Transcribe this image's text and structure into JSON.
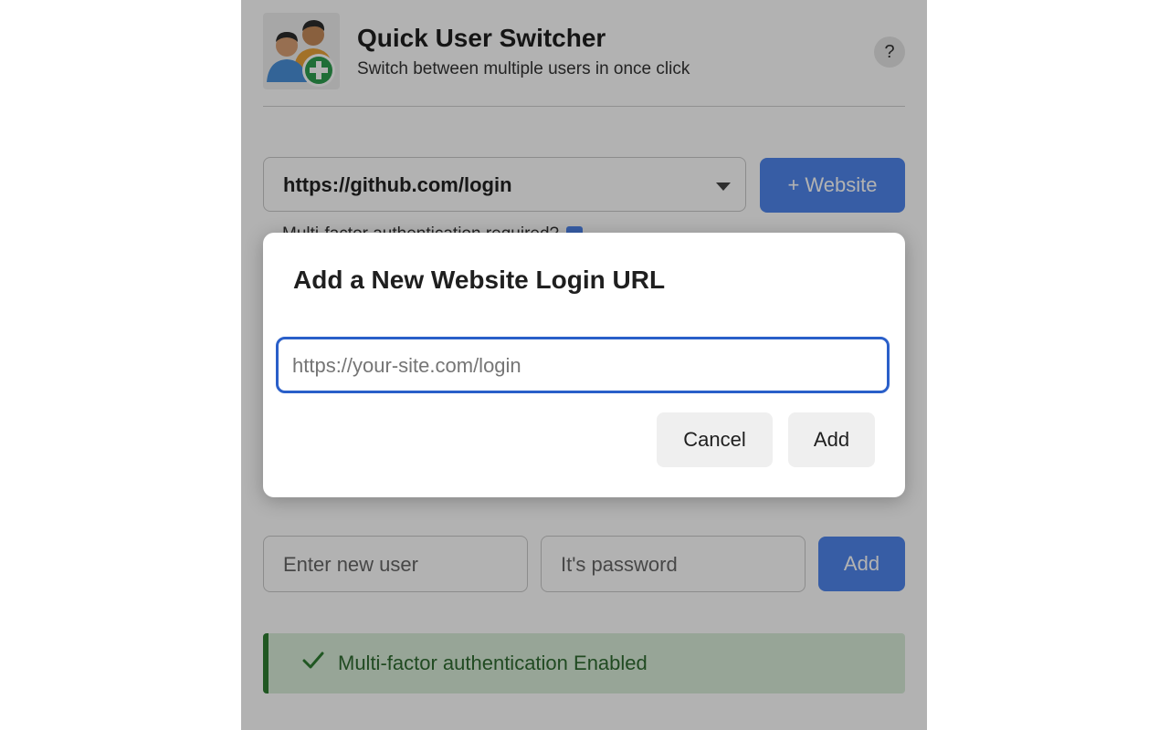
{
  "header": {
    "title": "Quick User Switcher",
    "subtitle": "Switch between multiple users in once click",
    "help_label": "?",
    "logo_icon": "users-add-icon"
  },
  "site_selector": {
    "selected": "https://github.com/login",
    "add_button_label": "+ Website"
  },
  "mfa_toggle": {
    "label": "Multi-factor authentication required?",
    "checked": true
  },
  "new_user_form": {
    "user_placeholder": "Enter new user",
    "password_placeholder": "It's password",
    "add_label": "Add"
  },
  "alert": {
    "message": "Multi-factor authentication Enabled",
    "icon": "check-icon"
  },
  "dialog": {
    "title": "Add a New Website Login URL",
    "input_placeholder": "https://your-site.com/login",
    "cancel_label": "Cancel",
    "add_label": "Add"
  },
  "colors": {
    "primary": "#4f86ec",
    "focus_border": "#2a5fc9",
    "success_bg": "#d8ecd9",
    "success_text": "#2e6b30"
  }
}
